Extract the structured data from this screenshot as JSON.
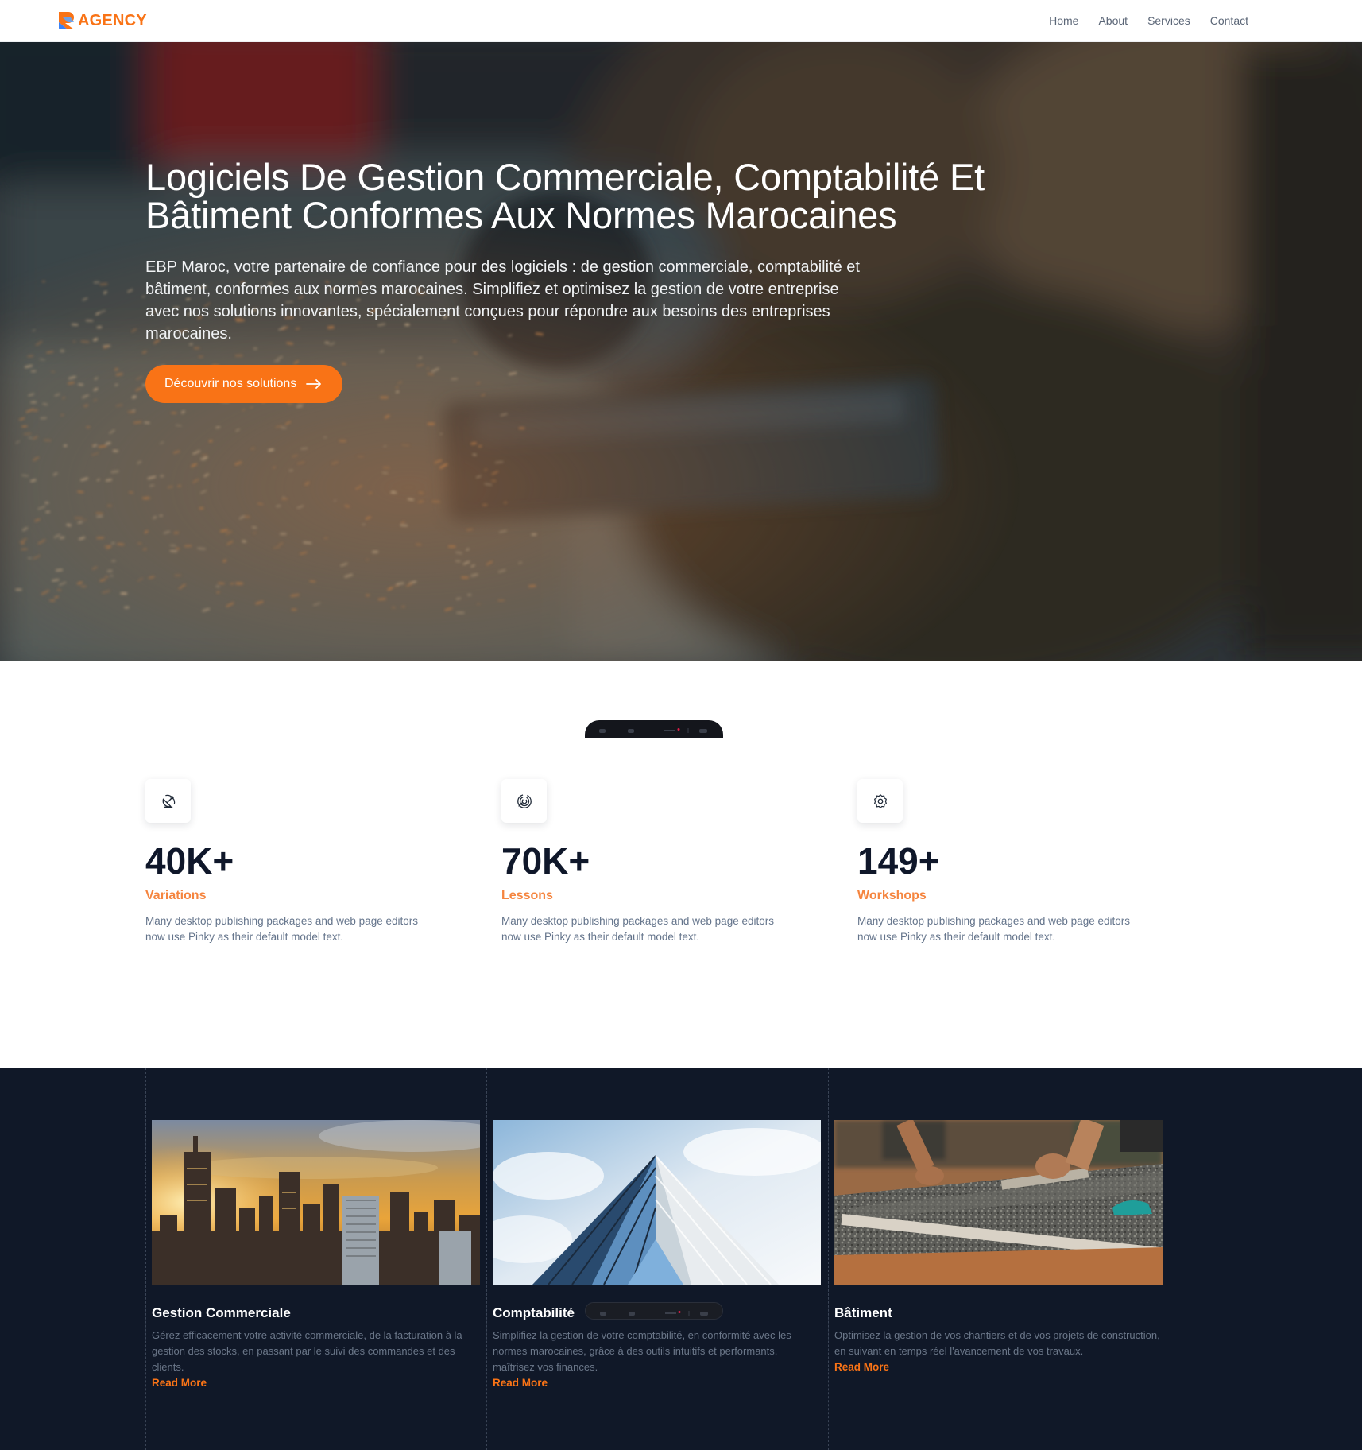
{
  "brand": {
    "name": "AGENCY",
    "color": "#f97316"
  },
  "nav": {
    "items": [
      {
        "label": "Home"
      },
      {
        "label": "About"
      },
      {
        "label": "Services"
      },
      {
        "label": "Contact"
      }
    ]
  },
  "hero": {
    "title": "Logiciels De Gestion Commerciale, Comptabilité Et Bâtiment Conformes Aux Normes Marocaines",
    "text": "EBP Maroc, votre partenaire de confiance pour des logiciels : de gestion commerciale, comptabilité et bâtiment, conformes aux normes marocaines. Simplifiez et optimisez la gestion de votre entreprise avec nos solutions innovantes, spécialement conçues pour répondre aux besoins des entreprises marocaines.",
    "cta_label": "Découvrir nos solutions",
    "cta_icon": "arrow-right-icon"
  },
  "stats": [
    {
      "icon": "satellite-dish-icon",
      "value": "40K+",
      "label": "Variations",
      "text": "Many desktop publishing packages and web page editors now use Pinky as their default model text."
    },
    {
      "icon": "fingerprint-icon",
      "value": "70K+",
      "label": "Lessons",
      "text": "Many desktop publishing packages and web page editors now use Pinky as their default model text."
    },
    {
      "icon": "gear-badge-icon",
      "value": "149+",
      "label": "Workshops",
      "text": "Many desktop publishing packages and web page editors now use Pinky as their default model text."
    }
  ],
  "services": [
    {
      "title": "Gestion Commerciale",
      "text": "Gérez efficacement votre activité commerciale, de la facturation à la gestion des stocks, en passant par le suivi des commandes et des clients.",
      "link": "Read More"
    },
    {
      "title": "Comptabilité",
      "text": "Simplifiez la gestion de votre comptabilité, en conformité avec les normes marocaines, grâce à des outils intuitifs et performants. maîtrisez vos finances.",
      "link": "Read More"
    },
    {
      "title": "Bâtiment",
      "text": "Optimisez la gestion de vos chantiers et de vos projets de construction, en suivant en temps réel l'avancement de vos travaux.",
      "link": "Read More"
    }
  ],
  "colors": {
    "accent": "#f97316",
    "dark_bg": "#101828",
    "heading": "#0f172a",
    "muted": "#64748b"
  }
}
